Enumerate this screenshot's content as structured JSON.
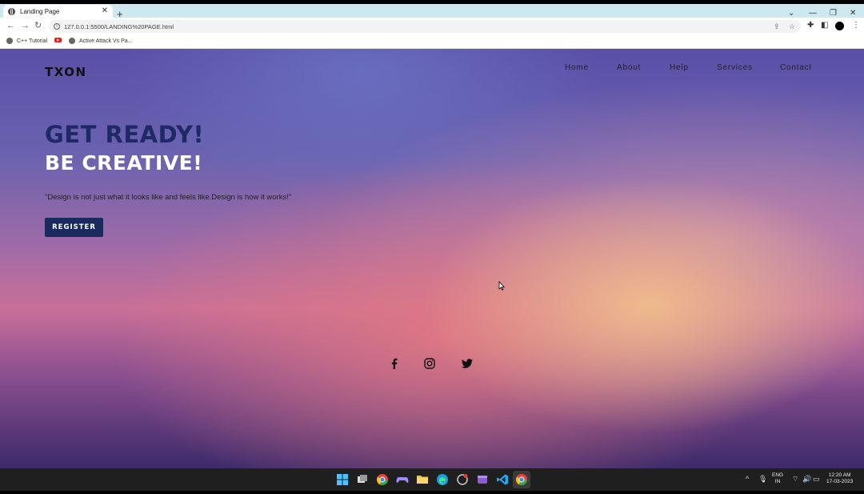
{
  "browser": {
    "tab_title": "Landing Page",
    "new_tab": "+",
    "url": "127.0.0.1:5500/LANDING%20PAGE.html",
    "bookmarks": [
      "C++ Tutorial",
      "Active Attack Vs Pa..."
    ]
  },
  "site": {
    "logo": "TXON",
    "nav": [
      "Home",
      "About",
      "Help",
      "Services",
      "Contact"
    ],
    "hero": {
      "line1": "GET READY!",
      "line2": "BE CREATIVE!",
      "quote": "\"Design is not just what it looks like and feels like.Design is how it works!\"",
      "button": "REGISTER"
    },
    "social": [
      "facebook-icon",
      "instagram-icon",
      "twitter-icon"
    ]
  },
  "taskbar": {
    "lang_top": "ENG",
    "lang_bottom": "IN",
    "time": "12:20 AM",
    "date": "17-03-2023"
  },
  "colors": {
    "hero_dark": "#1e2a63",
    "button": "#1a2a5c",
    "tabstrip": "#cde8ee"
  }
}
